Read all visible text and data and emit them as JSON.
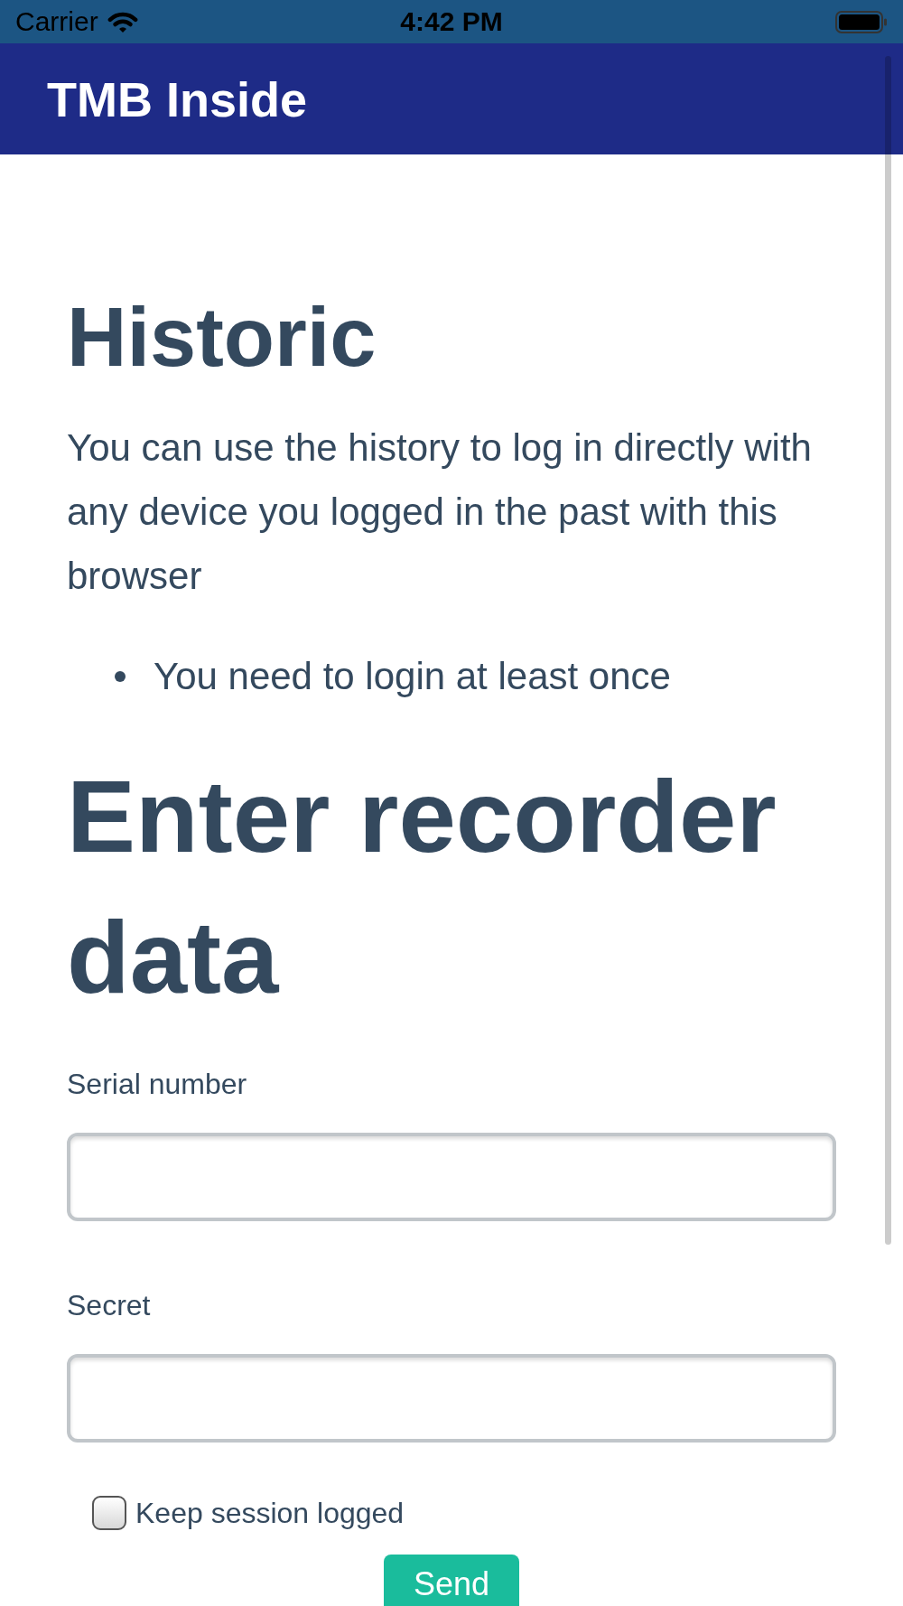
{
  "status_bar": {
    "carrier": "Carrier",
    "time": "4:42 PM"
  },
  "app_bar": {
    "title": "TMB Inside"
  },
  "historic": {
    "heading": "Historic",
    "paragraph": "You can use the history to log in directly with any device you logged in the past with this browser",
    "bullets": [
      "You need to login at least once"
    ]
  },
  "recorder_form": {
    "heading": "Enter recorder data",
    "fields": [
      {
        "label": "Serial number"
      },
      {
        "label": "Secret"
      }
    ],
    "checkbox": {
      "label": "Keep session logged",
      "checked": false
    },
    "submit": "Send"
  }
}
